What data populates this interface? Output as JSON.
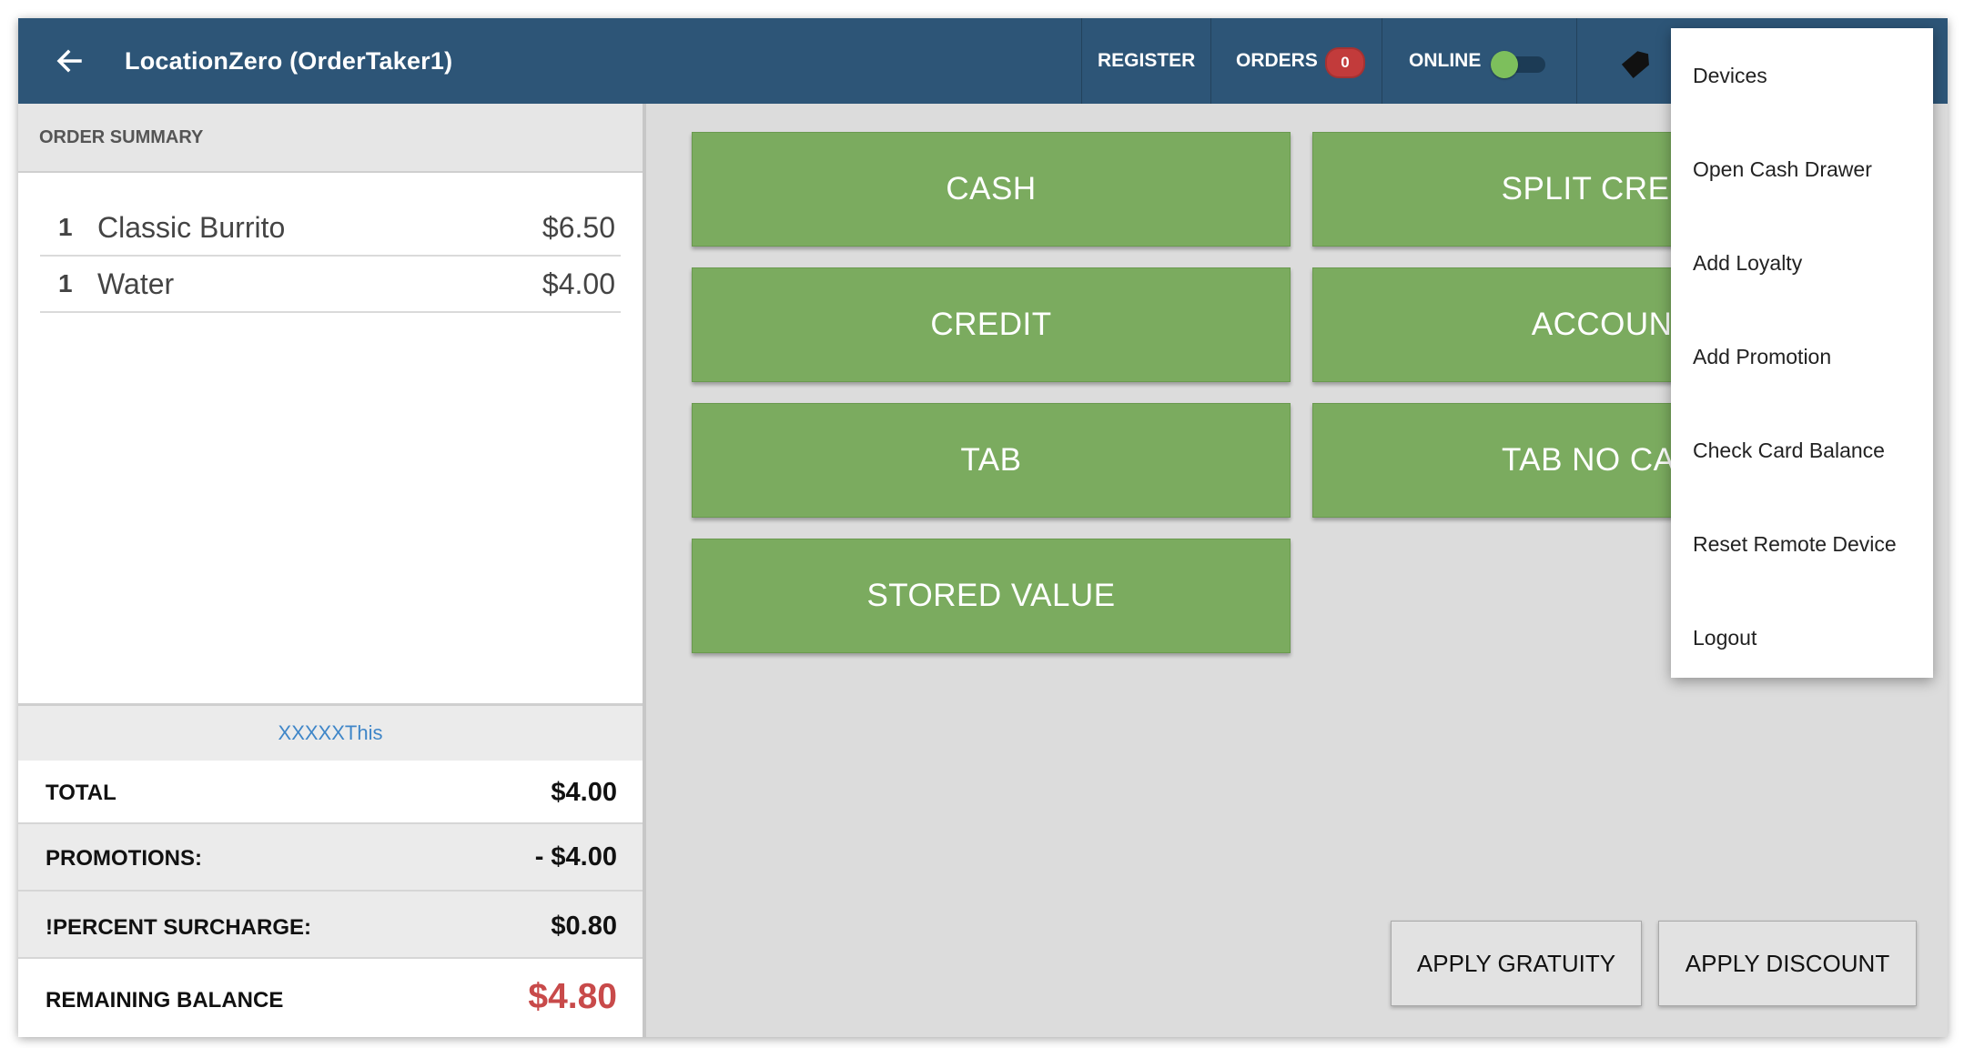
{
  "header": {
    "title": "LocationZero (OrderTaker1)",
    "register_label": "REGISTER",
    "orders_label": "ORDERS",
    "orders_count": "0",
    "online_label": "ONLINE",
    "online_toggle_on": true
  },
  "order_summary": {
    "header": "ORDER SUMMARY",
    "items": [
      {
        "qty": "1",
        "name": "Classic Burrito",
        "price": "$6.50"
      },
      {
        "qty": "1",
        "name": "Water",
        "price": "$4.00"
      }
    ],
    "promo_link": "XXXXXThis",
    "total_label": "TOTAL",
    "total_value": "$4.00",
    "promotions_label": "PROMOTIONS:",
    "promotions_value": "- $4.00",
    "surcharge_label": "!PERCENT SURCHARGE:",
    "surcharge_value": "$0.80",
    "remaining_label": "REMAINING BALANCE",
    "remaining_value": "$4.80"
  },
  "payment_buttons": {
    "cash": "CASH",
    "split_credit": "SPLIT CREDIT",
    "credit": "CREDIT",
    "account": "ACCOUNT",
    "tab": "TAB",
    "tab_no_card": "TAB NO CARD",
    "stored_value": "STORED VALUE"
  },
  "actions": {
    "apply_gratuity": "APPLY GRATUITY",
    "apply_discount": "APPLY DISCOUNT"
  },
  "menu": {
    "items": [
      "Devices",
      "Open Cash Drawer",
      "Add Loyalty",
      "Add Promotion",
      "Check Card Balance",
      "Reset Remote Device",
      "Logout"
    ]
  },
  "colors": {
    "topbar": "#2d5577",
    "pay_button": "#7bab5f",
    "badge": "#c23b3b",
    "remaining_balance": "#c84a4a",
    "link": "#3f86c8"
  },
  "icons": [
    "back-arrow-icon",
    "tag-icon"
  ]
}
